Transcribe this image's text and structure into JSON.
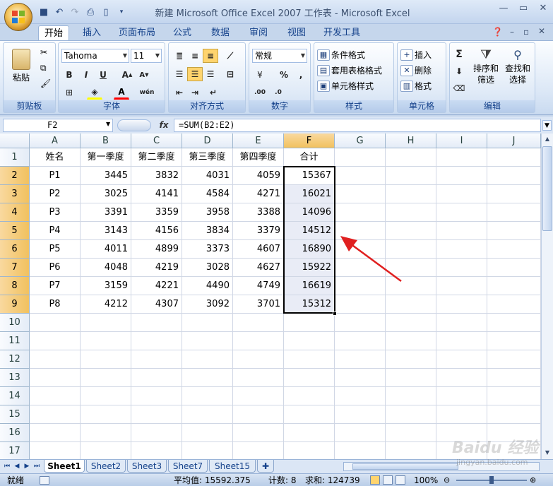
{
  "window": {
    "title": "新建 Microsoft Office Excel 2007 工作表 - Microsoft Excel"
  },
  "ribbon_tabs": [
    "开始",
    "插入",
    "页面布局",
    "公式",
    "数据",
    "审阅",
    "视图",
    "开发工具"
  ],
  "ribbon": {
    "clipboard": {
      "label": "剪贴板",
      "paste": "粘贴"
    },
    "font": {
      "label": "字体",
      "name": "Tahoma",
      "size": "11"
    },
    "alignment": {
      "label": "对齐方式"
    },
    "number": {
      "label": "数字",
      "format": "常规"
    },
    "styles": {
      "label": "样式",
      "conditional": "条件格式",
      "table": "套用表格格式",
      "cell": "单元格样式"
    },
    "cells": {
      "label": "单元格",
      "insert": "插入",
      "delete": "删除",
      "format": "格式"
    },
    "editing": {
      "label": "编辑",
      "sort_filter_1": "排序和",
      "sort_filter_2": "筛选",
      "find_1": "查找和",
      "find_2": "选择"
    }
  },
  "formula_bar": {
    "name_box": "F2",
    "fx": "fx",
    "formula": "=SUM(B2:E2)"
  },
  "columns": [
    "A",
    "B",
    "C",
    "D",
    "E",
    "F",
    "G",
    "H",
    "I",
    "J"
  ],
  "rows": [
    "1",
    "2",
    "3",
    "4",
    "5",
    "6",
    "7",
    "8",
    "9",
    "10",
    "11",
    "12",
    "13",
    "14",
    "15",
    "16",
    "17"
  ],
  "table": {
    "headers": [
      "姓名",
      "第一季度",
      "第二季度",
      "第三季度",
      "第四季度",
      "合计"
    ],
    "rows": [
      [
        "P1",
        "3445",
        "3832",
        "4031",
        "4059",
        "15367"
      ],
      [
        "P2",
        "3025",
        "4141",
        "4584",
        "4271",
        "16021"
      ],
      [
        "P3",
        "3391",
        "3359",
        "3958",
        "3388",
        "14096"
      ],
      [
        "P4",
        "3143",
        "4156",
        "3834",
        "3379",
        "14512"
      ],
      [
        "P5",
        "4011",
        "4899",
        "3373",
        "4607",
        "16890"
      ],
      [
        "P6",
        "4048",
        "4219",
        "3028",
        "4627",
        "15922"
      ],
      [
        "P7",
        "3159",
        "4221",
        "4490",
        "4749",
        "16619"
      ],
      [
        "P8",
        "4212",
        "4307",
        "3092",
        "3701",
        "15312"
      ]
    ]
  },
  "sheets": [
    "Sheet1",
    "Sheet2",
    "Sheet3",
    "Sheet7",
    "Sheet15"
  ],
  "status": {
    "ready": "就绪",
    "average": "平均值: 15592.375",
    "count": "计数: 8",
    "sum": "求和: 124739",
    "zoom": "100%"
  },
  "watermark": {
    "text": "Baidu 经验",
    "url": "jingyan.baidu.com"
  },
  "colors": {
    "arrow": "#e02020",
    "selection_fill": "#e9ecf6",
    "header_selected": "#f1c15f"
  }
}
